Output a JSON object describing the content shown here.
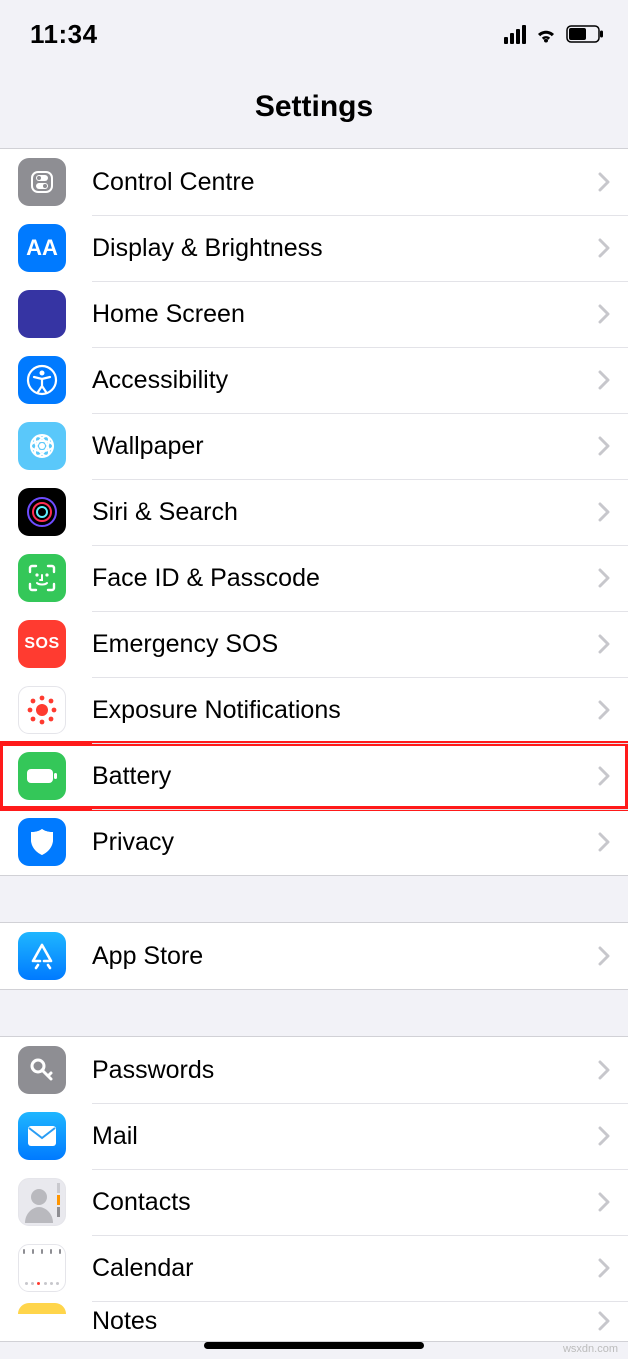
{
  "status": {
    "time": "11:34"
  },
  "header": {
    "title": "Settings"
  },
  "sections": [
    {
      "rows": [
        {
          "key": "control-centre",
          "label": "Control Centre"
        },
        {
          "key": "display-brightness",
          "label": "Display & Brightness"
        },
        {
          "key": "home-screen",
          "label": "Home Screen"
        },
        {
          "key": "accessibility",
          "label": "Accessibility"
        },
        {
          "key": "wallpaper",
          "label": "Wallpaper"
        },
        {
          "key": "siri-search",
          "label": "Siri & Search"
        },
        {
          "key": "face-id-passcode",
          "label": "Face ID & Passcode"
        },
        {
          "key": "emergency-sos",
          "label": "Emergency SOS"
        },
        {
          "key": "exposure-notifications",
          "label": "Exposure Notifications"
        },
        {
          "key": "battery",
          "label": "Battery",
          "highlighted": true
        },
        {
          "key": "privacy",
          "label": "Privacy"
        }
      ]
    },
    {
      "rows": [
        {
          "key": "app-store",
          "label": "App Store"
        }
      ]
    },
    {
      "rows": [
        {
          "key": "passwords",
          "label": "Passwords"
        },
        {
          "key": "mail",
          "label": "Mail"
        },
        {
          "key": "contacts",
          "label": "Contacts"
        },
        {
          "key": "calendar",
          "label": "Calendar"
        },
        {
          "key": "notes",
          "label": "Notes"
        }
      ]
    }
  ],
  "watermark": "wsxdn.com"
}
